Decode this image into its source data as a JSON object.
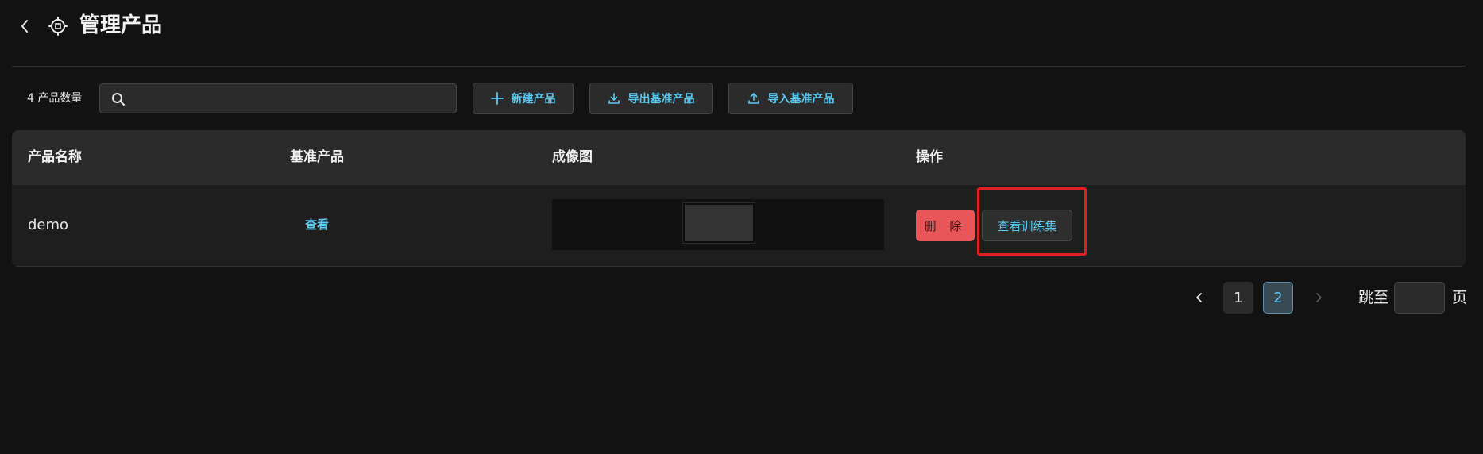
{
  "header": {
    "title": "管理产品",
    "back_icon": "chevron-left-icon",
    "settings_icon": "chip-settings-icon"
  },
  "toolbar": {
    "count_label": "4 产品数量",
    "search": {
      "value": "",
      "placeholder": ""
    },
    "new_product_label": "新建产品",
    "export_label": "导出基准产品",
    "import_label": "导入基准产品"
  },
  "table": {
    "columns": [
      "产品名称",
      "基准产品",
      "成像图",
      "操作"
    ],
    "rows": [
      {
        "name": "demo",
        "baseline_link": "查看",
        "delete_label": "删 除",
        "view_training_label": "查看训练集"
      }
    ]
  },
  "pagination": {
    "pages": [
      "1",
      "2"
    ],
    "current_page": 2,
    "jump_label": "跳至",
    "jump_value": "",
    "page_suffix": "页"
  },
  "colors": {
    "background": "#121212",
    "accent": "#5cc8f0",
    "danger": "#e8565a",
    "highlight_box": "#e0201e"
  }
}
